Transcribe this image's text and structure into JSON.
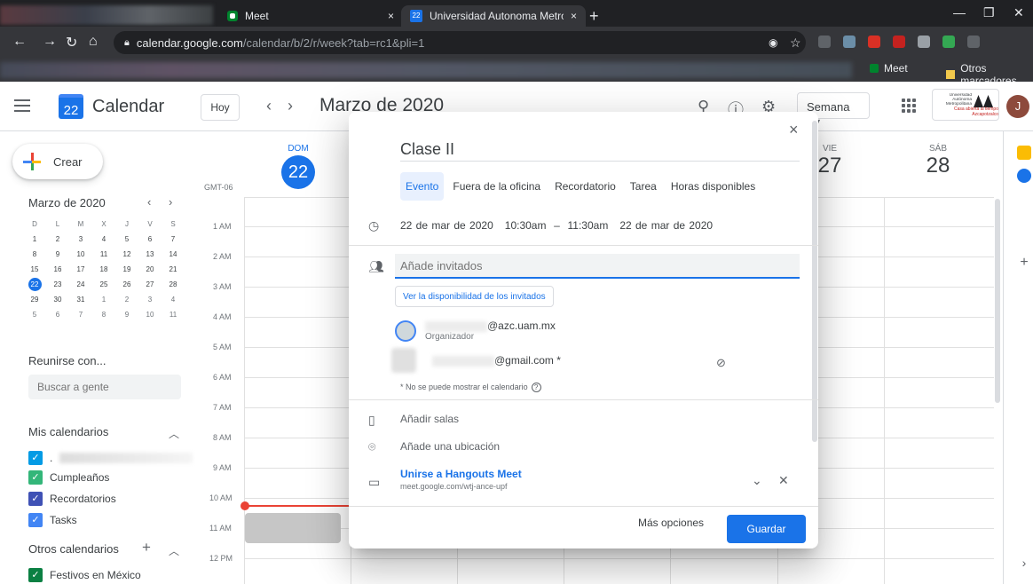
{
  "browser": {
    "tabs": [
      {
        "title": "Meet",
        "close": "×"
      },
      {
        "title": "Universidad Autonoma Metropol",
        "close": "×",
        "icon_text": "22"
      }
    ],
    "new_tab": "+",
    "url_host": "calendar.google.com",
    "url_path": "/calendar/b/2/r/week?tab=rc1&pli=1",
    "bookmarks": [
      {
        "label": "Meet"
      },
      {
        "label": "Otros marcadores"
      }
    ]
  },
  "header": {
    "logo_day": "22",
    "app_name": "Calendar",
    "today_label": "Hoy",
    "month_title": "Marzo de 2020",
    "view_label": "Semana",
    "avatar_letter": "J",
    "uam_logo_text": "Universidad Autónoma Metropolitana",
    "uam_logo_sub": "Casa abierta al tiempo Azcapotzalco"
  },
  "sidebar": {
    "create_label": "Crear",
    "mini_title": "Marzo de 2020",
    "dow": [
      "D",
      "L",
      "M",
      "X",
      "J",
      "V",
      "S"
    ],
    "weeks": [
      [
        "1",
        "2",
        "3",
        "4",
        "5",
        "6",
        "7"
      ],
      [
        "8",
        "9",
        "10",
        "11",
        "12",
        "13",
        "14"
      ],
      [
        "15",
        "16",
        "17",
        "18",
        "19",
        "20",
        "21"
      ],
      [
        "22",
        "23",
        "24",
        "25",
        "26",
        "27",
        "28"
      ],
      [
        "29",
        "30",
        "31",
        "1",
        "2",
        "3",
        "4"
      ],
      [
        "5",
        "6",
        "7",
        "8",
        "9",
        "10",
        "11"
      ]
    ],
    "meet_with": "Reunirse con...",
    "search_people_placeholder": "Buscar a gente",
    "my_calendars_title": "Mis calendarios",
    "my_calendars": [
      {
        "label": ".",
        "color": "#039be5"
      },
      {
        "label": "Cumpleaños",
        "color": "#33b679"
      },
      {
        "label": "Recordatorios",
        "color": "#3f51b5"
      },
      {
        "label": "Tasks",
        "color": "#4285f4"
      }
    ],
    "other_calendars_title": "Otros calendarios",
    "other_calendars": [
      {
        "label": "Festivos en México",
        "color": "#0b8043"
      }
    ]
  },
  "grid": {
    "tz": "GMT-06",
    "days": [
      {
        "dow": "DOM",
        "num": "22"
      },
      {
        "dow": "VIE",
        "num": "27"
      },
      {
        "dow": "SÁB",
        "num": "28"
      }
    ],
    "hours": [
      "1 AM",
      "2 AM",
      "3 AM",
      "4 AM",
      "5 AM",
      "6 AM",
      "7 AM",
      "8 AM",
      "9 AM",
      "10 AM",
      "11 AM",
      "12 PM"
    ]
  },
  "dialog": {
    "close": "×",
    "title": "Clase II",
    "tabs": [
      "Evento",
      "Fuera de la oficina",
      "Recordatorio",
      "Tarea",
      "Horas disponibles"
    ],
    "date_start": "22 de mar de 2020",
    "time_start": "10:30am",
    "dash": "–",
    "time_end": "11:30am",
    "date_end": "22 de mar de 2020",
    "guest_placeholder": "Añade invitados",
    "availability_label": "Ver la disponibilidad de los invitados",
    "organizer_email": "@azc.uam.mx",
    "organizer_role": "Organizador",
    "guest_email": "@gmail.com *",
    "no_calendar_note": "* No se puede mostrar el calendario",
    "rooms": "Añadir salas",
    "location": "Añade una ubicación",
    "meet_join": "Unirse a Hangouts Meet",
    "meet_url": "meet.google.com/wtj-ance-upf",
    "more_options": "Más opciones",
    "save": "Guardar"
  },
  "colors": {
    "accent": "#1a73e8",
    "now_line": "#ea4335"
  }
}
